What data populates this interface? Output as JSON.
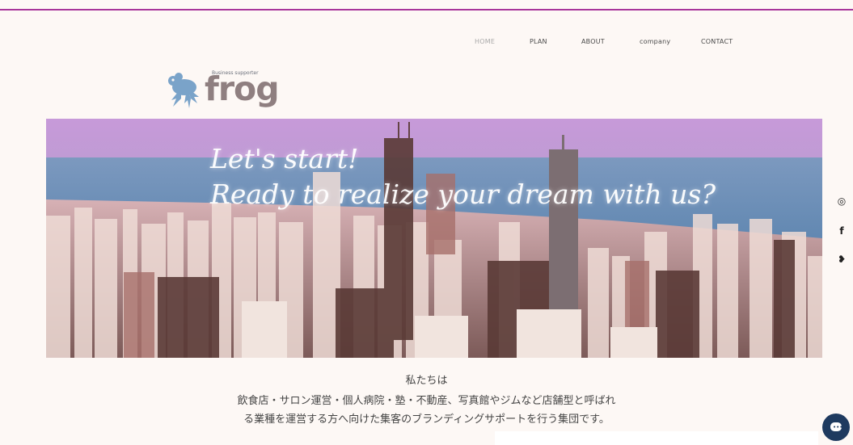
{
  "nav": {
    "items": [
      {
        "label": "HOME",
        "active": true
      },
      {
        "label": "PLAN",
        "active": false
      },
      {
        "label": "ABOUT",
        "active": false
      },
      {
        "label": "company",
        "active": false
      },
      {
        "label": "CONTACT",
        "active": false
      }
    ]
  },
  "logo": {
    "tagline": "Business supporter",
    "word": "frog",
    "icon": "frog-icon",
    "color": "#8f7f80",
    "icon_color": "#7aa3c9"
  },
  "hero": {
    "line1": "Let's start!",
    "line2": "Ready to realize your dream with us?"
  },
  "social": {
    "icons": [
      "instagram-icon",
      "facebook-icon",
      "twitter-icon"
    ],
    "glyphs": [
      "◎",
      "f",
      "❥"
    ]
  },
  "intro": {
    "line1": "私たちは",
    "line2": "飲食店・サロン運営・個人病院・塾・不動産、写真館やジムなど店舗型と呼ばれ",
    "line3": "る業種を運営する方へ向けた集客のブランディングサポートを行う集団です。"
  },
  "chat": {
    "icon": "chat-icon",
    "dots": "•••"
  },
  "colors": {
    "accent_line": "#a8359a",
    "background": "#fdf8f5",
    "chat": "#1e3a5f"
  }
}
